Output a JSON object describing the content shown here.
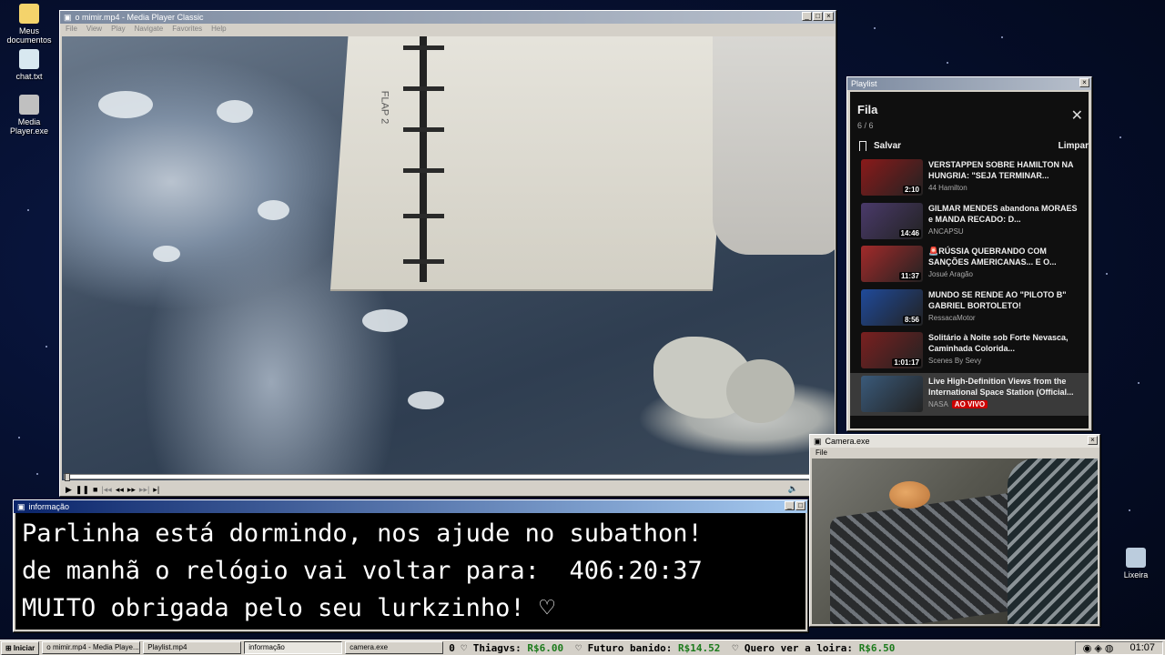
{
  "desktop": {
    "icons": [
      {
        "label": "Meus documentos"
      },
      {
        "label": "chat.txt"
      },
      {
        "label": "Media Player.exe"
      },
      {
        "label": "Lixeira"
      }
    ]
  },
  "media_player": {
    "title": "o mimir.mp4 - Media Player Classic",
    "menu": [
      "File",
      "View",
      "Play",
      "Navigate",
      "Favorites",
      "Help"
    ],
    "video_label": "FLAP 2"
  },
  "playlist_window": {
    "title": "Playlist",
    "heading": "Fila",
    "count": "6 / 6",
    "save_label": "Salvar",
    "clear_label": "Limpar",
    "items": [
      {
        "title": "VERSTAPPEN SOBRE HAMILTON NA HUNGRIA: \"SEJA TERMINAR...",
        "channel": "44 Hamilton",
        "duration": "2:10",
        "thumb_color": "#8a1a1a"
      },
      {
        "title": "GILMAR MENDES abandona MORAES e MANDA RECADO: D...",
        "channel": "ANCAPSU",
        "duration": "14:46",
        "thumb_color": "#4a3a6a"
      },
      {
        "title": "🚨RÚSSIA QUEBRANDO COM SANÇÕES AMERICANAS... E O...",
        "channel": "Josué Aragão",
        "duration": "11:37",
        "thumb_color": "#a22a2a"
      },
      {
        "title": "MUNDO SE RENDE AO \"PILOTO B\" GABRIEL BORTOLETO!",
        "channel": "RessacaMotor",
        "duration": "8:56",
        "thumb_color": "#1f4a9a"
      },
      {
        "title": "Solitário à Noite sob Forte Nevasca, Caminhada Colorida...",
        "channel": "Scenes By Sevy",
        "duration": "1:01:17",
        "thumb_color": "#7a2020"
      },
      {
        "title": "Live High-Definition Views from the International Space Station (Official...",
        "channel": "NASA",
        "live": "AO VIVO",
        "thumb_color": "#3a5a7a"
      }
    ]
  },
  "info_window": {
    "title": "informação",
    "lines": [
      "Parlinha está dormindo, nos ajude no subathon!",
      "de manhã o relógio vai voltar para:  406:20:37",
      "MUITO obrigada pelo seu lurkzinho! ♡"
    ]
  },
  "camera_window": {
    "title": "Camera.exe",
    "menu": "File"
  },
  "taskbar": {
    "start_label": "Iniciar",
    "tasks": [
      {
        "label": "o mimir.mp4 - Media Playe..."
      },
      {
        "label": "Playlist.mp4"
      },
      {
        "label": "informação"
      },
      {
        "label": "camera.exe"
      }
    ],
    "ticker": [
      {
        "prefix": "0 ♡",
        "name": "Thiagvs:",
        "amount": "R$6.00"
      },
      {
        "prefix": "♡",
        "name": "Futuro banido:",
        "amount": "R$14.52"
      },
      {
        "prefix": "♡",
        "name": "Quero ver a loira:",
        "amount": "R$6.50"
      }
    ],
    "clock": "01:07"
  }
}
